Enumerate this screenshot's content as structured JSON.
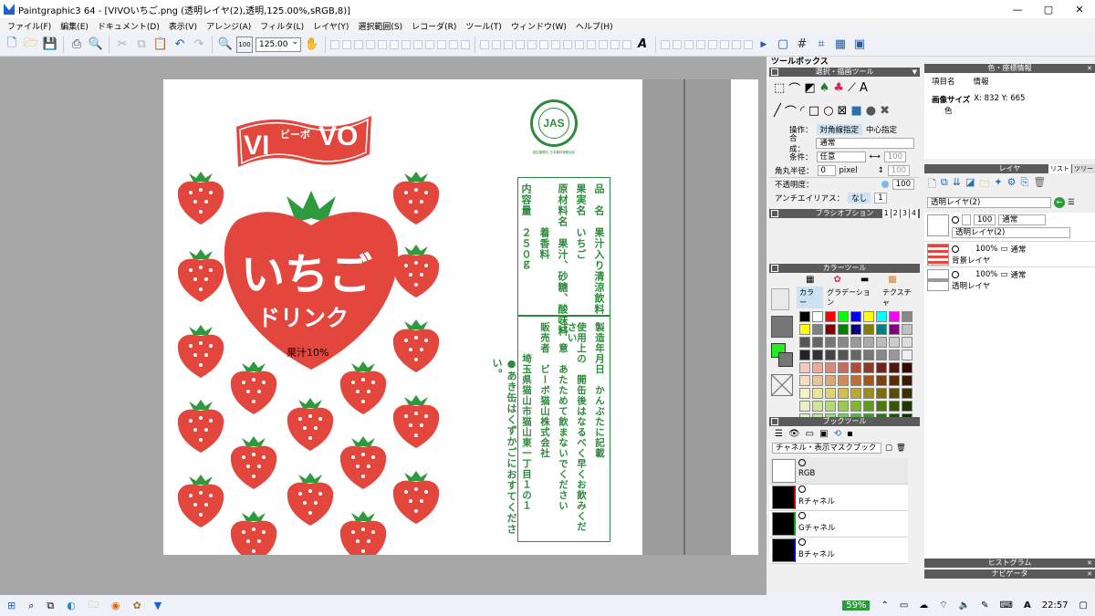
{
  "window": {
    "title": "Paintgraphic3 64 - [VIVOいちご.png (透明レイヤ(2),透明,125.00%,sRGB,8)]",
    "min": "—",
    "max": "▢",
    "close": "✕"
  },
  "menu": [
    "ファイル(F)",
    "編集(E)",
    "ドキュメント(D)",
    "表示(V)",
    "アレンジ(A)",
    "フィルタ(L)",
    "レイヤ(Y)",
    "選択範囲(S)",
    "レコーダ(R)",
    "ツール(T)",
    "ウィンドウ(W)",
    "ヘルプ(H)"
  ],
  "toolbar": {
    "zoom_button": "100",
    "zoom_value": "125.00"
  },
  "artwork": {
    "brand_left": "VI",
    "brand_small": "ビーボ",
    "brand_right": "VO",
    "product_line1": "いちご",
    "product_line2": "ドリンク",
    "juice": "果汁10%",
    "jas": "JAS",
    "jas_ring": "認定機関名 日本農林規格協会",
    "label_cols": [
      "品　名　果汁入り清涼飲料",
      "果実名　いちご",
      "原材料名　果汁、砂糖、酸味料",
      "　　　　着香料",
      "内容量　２５０ｇ"
    ],
    "label_cols2": [
      "製造年月日　かんぶたに記載",
      "使用上の　開缶後はなるべく早くお飲みください",
      "注　意　あたためて飲まないでください",
      "販売者　ビーボ猫山株式会社",
      "　　　埼玉県猫山市猫山東一丁目１の１"
    ],
    "note": "●あき缶はくずかごにおすてください。"
  },
  "toolbox": {
    "header": "ツールボックス",
    "subheader": "選択・描画ツール",
    "op_label": "操作：",
    "op_a": "対角線指定",
    "op_b": "中心指定",
    "blend_label": "合成：",
    "blend_value": "通常",
    "cond_label": "条件：",
    "cond_value": "任意",
    "cond_num": "100",
    "radius_label": "角丸半径：",
    "radius_value": "0",
    "radius_unit": "pixel",
    "radius_num": "100",
    "opacity_label": "不透明度：",
    "opacity_value": "100",
    "aa_label": "アンチエイリアス：",
    "aa_value": "なし",
    "aa_num": "1",
    "brush_header": "ブラシオプション",
    "brush_tabs": [
      "1",
      "2",
      "3",
      "4"
    ],
    "color_header": "カラーツール",
    "color_tabs": [
      "カラー",
      "グラデーション",
      "テクスチャ"
    ],
    "book_header": "ブックツール",
    "channel_select": "チャネル・表示マスクブック",
    "channels": [
      "RGB",
      "Rチャネル",
      "Gチャネル",
      "Bチャネル"
    ]
  },
  "info": {
    "header": "色・座標情報",
    "col1": "項目名",
    "col2": "情報",
    "row1_name": "画像サイズ",
    "row1_value": "X: 832  Y: 665",
    "row2_name": "色"
  },
  "layers": {
    "header": "レイヤ",
    "tab1": "リスト",
    "tab2": "ツリー",
    "current": "透明レイヤ(2)",
    "opacity": "100",
    "blend": "通常",
    "items": [
      {
        "name": "透明レイヤ(2)"
      },
      {
        "name": "背景レイヤ",
        "opacity": "100%",
        "blend": "通常"
      },
      {
        "name": "透明レイヤ",
        "opacity": "100%",
        "blend": "通常"
      }
    ]
  },
  "bottom_panels": {
    "histogram": "ヒストグラム",
    "navigator": "ナビゲータ"
  },
  "taskbar": {
    "battery": "59%",
    "time": "22:57"
  },
  "colors": {
    "red": "#e2463d",
    "green": "#2e8b3d"
  }
}
